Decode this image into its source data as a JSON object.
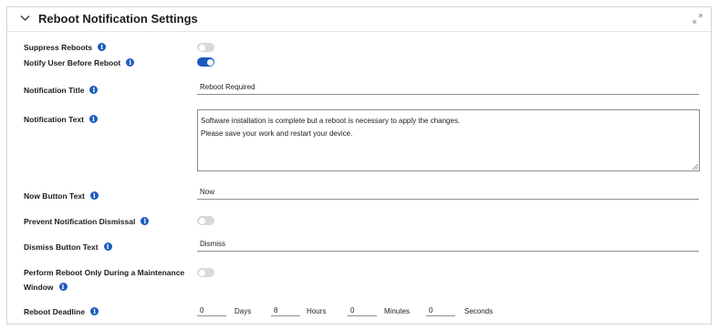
{
  "panel": {
    "title": "Reboot Notification Settings",
    "chevron_icon": "chevron-down-icon",
    "expand_icon": "expand-icon"
  },
  "fields": {
    "suppress_reboots": {
      "label": "Suppress Reboots",
      "enabled": false
    },
    "notify_user": {
      "label": "Notify User Before Reboot",
      "enabled": true
    },
    "notification_title": {
      "label": "Notification Title",
      "value": "Reboot Required"
    },
    "notification_text": {
      "label": "Notification Text",
      "lines": [
        "Software installation is complete but a reboot is necessary to apply the changes.",
        "Please save your work and restart your device."
      ]
    },
    "now_button_text": {
      "label": "Now Button Text",
      "value": "Now"
    },
    "prevent_dismissal": {
      "label": "Prevent Notification Dismissal",
      "enabled": false
    },
    "dismiss_button_text": {
      "label": "Dismiss Button Text",
      "value": "Dismiss"
    },
    "maintenance_window": {
      "label_line1": "Perform Reboot Only During a Maintenance",
      "label_line2": "Window",
      "enabled": false
    },
    "reboot_deadline": {
      "label": "Reboot Deadline",
      "days": "0",
      "days_label": "Days",
      "hours": "8",
      "hours_label": "Hours",
      "minutes": "0",
      "minutes_label": "Minutes",
      "seconds": "0",
      "seconds_label": "Seconds"
    }
  },
  "info_icon": {
    "glyph": "i",
    "color": "#1d5bbf"
  },
  "colors": {
    "toggle_on": "#1d5bbf",
    "toggle_off": "#d6d9dd",
    "accent": "#1d5bbf"
  }
}
